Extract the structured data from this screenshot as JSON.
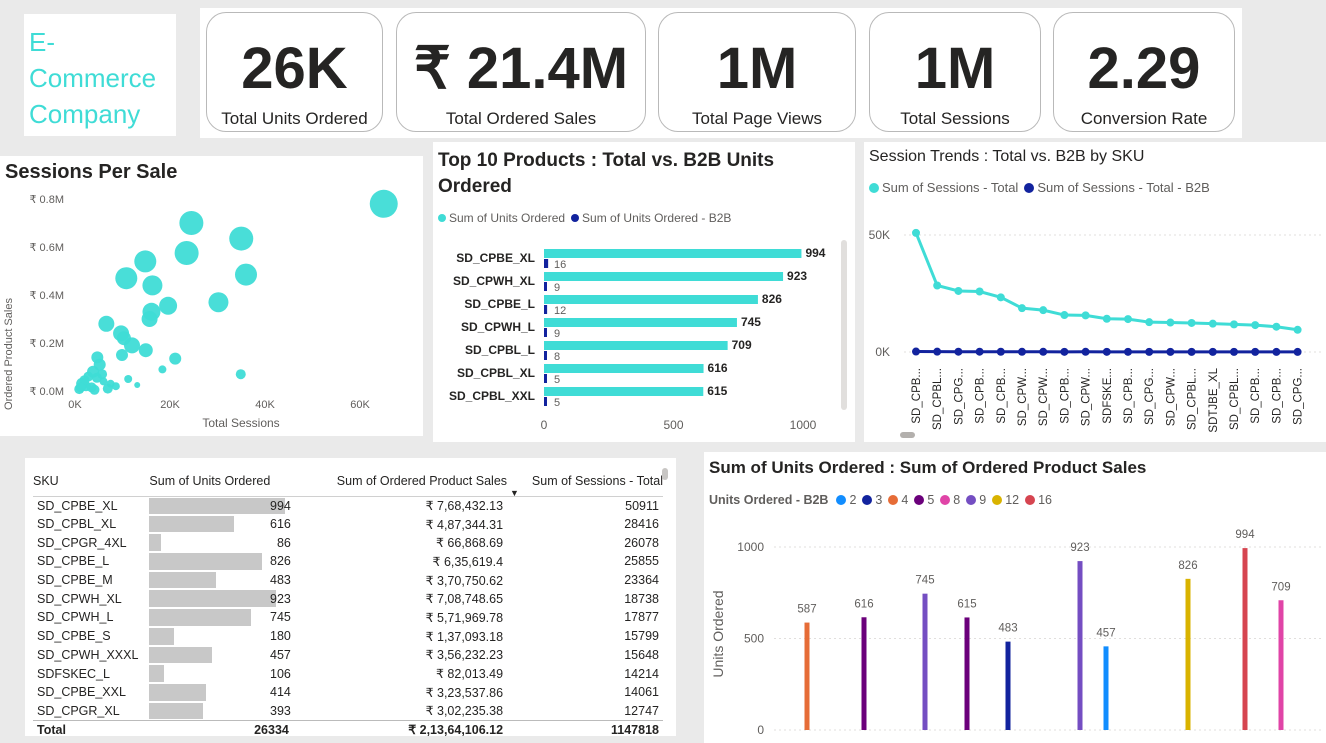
{
  "company": {
    "title": "E-Commerce Company"
  },
  "kpis": [
    {
      "value": "26K",
      "label": "Total Units Ordered"
    },
    {
      "value": "₹ 21.4M",
      "label": "Total Ordered Sales"
    },
    {
      "value": "1M",
      "label": "Total Page Views"
    },
    {
      "value": "1M",
      "label": "Total Sessions"
    },
    {
      "value": "2.29",
      "label": "Conversion Rate"
    }
  ],
  "scatter": {
    "title": "Sessions Per Sale",
    "xlabel": "Total Sessions",
    "ylabel": "Ordered Product Sales",
    "color": "#3fdcd6",
    "xticks": [
      "0K",
      "20K",
      "40K",
      "60K"
    ],
    "yticks": [
      "₹ 0.0M",
      "₹ 0.2M",
      "₹ 0.4M",
      "₹ 0.6M",
      "₹ 0.8M"
    ]
  },
  "top10": {
    "title": "Top 10 Products : Total vs. B2B Units Ordered",
    "legend": [
      "Sum of Units Ordered",
      "Sum of Units Ordered - B2B"
    ],
    "colors": [
      "#3fdcd6",
      "#12239e"
    ],
    "xticks": [
      "0",
      "500",
      "1000"
    ]
  },
  "trend": {
    "title": "Session Trends : Total vs. B2B by SKU",
    "legend": [
      "Sum of Sessions - Total",
      "Sum of Sessions - Total - B2B"
    ],
    "colors": [
      "#3fdcd6",
      "#12239e"
    ],
    "yticks": [
      "50K",
      "0K"
    ]
  },
  "table": {
    "headers": [
      "SKU",
      "Sum of Units Ordered",
      "Sum of Ordered Product Sales",
      "Sum of Sessions - Total"
    ],
    "rows": [
      [
        "SD_CPBE_XL",
        "994",
        "₹ 7,68,432.13",
        "50911"
      ],
      [
        "SD_CPBL_XL",
        "616",
        "₹ 4,87,344.31",
        "28416"
      ],
      [
        "SD_CPGR_4XL",
        "86",
        "₹ 66,868.69",
        "26078"
      ],
      [
        "SD_CPBE_L",
        "826",
        "₹ 6,35,619.4",
        "25855"
      ],
      [
        "SD_CPBE_M",
        "483",
        "₹ 3,70,750.62",
        "23364"
      ],
      [
        "SD_CPWH_XL",
        "923",
        "₹ 7,08,748.65",
        "18738"
      ],
      [
        "SD_CPWH_L",
        "745",
        "₹ 5,71,969.78",
        "17877"
      ],
      [
        "SD_CPBE_S",
        "180",
        "₹ 1,37,093.18",
        "15799"
      ],
      [
        "SD_CPWH_XXXL",
        "457",
        "₹ 3,56,232.23",
        "15648"
      ],
      [
        "SDFSKEC_L",
        "106",
        "₹ 82,013.49",
        "14214"
      ],
      [
        "SD_CPBE_XXL",
        "414",
        "₹ 3,23,537.86",
        "14061"
      ],
      [
        "SD_CPGR_XL",
        "393",
        "₹ 3,02,235.38",
        "12747"
      ]
    ],
    "total": [
      "Total",
      "26334",
      "₹ 2,13,64,106.12",
      "1147818"
    ],
    "bar_max": 994
  },
  "units_chart": {
    "title": "Sum of Units Ordered : Sum of Ordered Product Sales",
    "legend_title": "Units Ordered - B2B",
    "legend": [
      {
        "label": "2",
        "color": "#118dff"
      },
      {
        "label": "3",
        "color": "#12239e"
      },
      {
        "label": "4",
        "color": "#e66c37"
      },
      {
        "label": "5",
        "color": "#6b007b"
      },
      {
        "label": "8",
        "color": "#e044a7"
      },
      {
        "label": "9",
        "color": "#744ec2"
      },
      {
        "label": "12",
        "color": "#d9b300"
      },
      {
        "label": "16",
        "color": "#d64550"
      }
    ],
    "ylabel": "Units Ordered",
    "yticks": [
      "1000",
      "500",
      "0"
    ]
  },
  "chart_data": [
    {
      "type": "scatter",
      "title": "Sessions Per Sale",
      "xlabel": "Total Sessions",
      "ylabel": "Ordered Product Sales",
      "xlim": [
        0,
        70000
      ],
      "ylim": [
        0,
        800000
      ],
      "points": [
        [
          65000,
          780000,
          14
        ],
        [
          24500,
          700000,
          12
        ],
        [
          35000,
          635000,
          12
        ],
        [
          23500,
          575000,
          12
        ],
        [
          36000,
          485000,
          11
        ],
        [
          14800,
          540000,
          11
        ],
        [
          10800,
          470000,
          11
        ],
        [
          16300,
          440000,
          10
        ],
        [
          30200,
          370000,
          10
        ],
        [
          19600,
          355000,
          9
        ],
        [
          16100,
          330000,
          9
        ],
        [
          15700,
          300000,
          8
        ],
        [
          6600,
          280000,
          8
        ],
        [
          9700,
          240000,
          8
        ],
        [
          10300,
          220000,
          7
        ],
        [
          12000,
          190000,
          8
        ],
        [
          14900,
          170000,
          7
        ],
        [
          21100,
          135000,
          6
        ],
        [
          9900,
          150000,
          6
        ],
        [
          4700,
          140000,
          6
        ],
        [
          5200,
          110000,
          6
        ],
        [
          3800,
          80000,
          6
        ],
        [
          5700,
          70000,
          5
        ],
        [
          2800,
          60000,
          5
        ],
        [
          1500,
          30000,
          6
        ],
        [
          2300,
          20000,
          5
        ],
        [
          3500,
          15000,
          5
        ],
        [
          6000,
          40000,
          4
        ],
        [
          7500,
          30000,
          4
        ],
        [
          8600,
          20000,
          4
        ],
        [
          11200,
          50000,
          4
        ],
        [
          18400,
          90000,
          4
        ],
        [
          34900,
          70000,
          5
        ],
        [
          13100,
          25000,
          3
        ],
        [
          900,
          8000,
          5
        ],
        [
          4100,
          5000,
          5
        ],
        [
          6900,
          10000,
          5
        ],
        [
          2000,
          45000,
          5
        ],
        [
          4600,
          55000,
          5
        ],
        [
          1200,
          15000,
          5
        ]
      ]
    },
    {
      "type": "bar",
      "title": "Top 10 Products : Total vs. B2B Units Ordered",
      "orientation": "horizontal",
      "categories": [
        "SD_CPBE_XL",
        "SD_CPWH_XL",
        "SD_CPBE_L",
        "SD_CPWH_L",
        "SD_CPBL_L",
        "SD_CPBL_XL",
        "SD_CPBL_XXL"
      ],
      "series": [
        {
          "name": "Sum of Units Ordered",
          "values": [
            994,
            923,
            826,
            745,
            709,
            616,
            615
          ]
        },
        {
          "name": "Sum of Units Ordered - B2B",
          "values": [
            16,
            9,
            12,
            9,
            8,
            5,
            5
          ]
        }
      ],
      "xlim": [
        0,
        1050
      ]
    },
    {
      "type": "line",
      "title": "Session Trends : Total vs. B2B by SKU",
      "categories": [
        "SD_CPB...",
        "SD_CPBL...",
        "SD_CPG...",
        "SD_CPB...",
        "SD_CPB...",
        "SD_CPW...",
        "SD_CPW...",
        "SD_CPB...",
        "SD_CPW...",
        "SDFSKE...",
        "SD_CPB...",
        "SD_CPG...",
        "SD_CPW...",
        "SD_CPBL...",
        "SDTJBE_XL",
        "SD_CPBL...",
        "SD_CPB...",
        "SD_CPB...",
        "SD_CPG..."
      ],
      "series": [
        {
          "name": "Sum of Sessions - Total",
          "values": [
            50911,
            28416,
            26078,
            25855,
            23364,
            18738,
            17877,
            15799,
            15648,
            14214,
            14061,
            12747,
            12600,
            12400,
            12100,
            11800,
            11500,
            10800,
            9500
          ]
        },
        {
          "name": "Sum of Sessions - Total - B2B",
          "values": [
            200,
            150,
            120,
            130,
            110,
            100,
            90,
            80,
            85,
            70,
            75,
            60,
            60,
            55,
            50,
            52,
            48,
            45,
            40
          ]
        }
      ],
      "ylim": [
        0,
        60000
      ]
    },
    {
      "type": "bar",
      "title": "Sum of Units Ordered : Sum of Ordered Product Sales",
      "ylabel": "Units Ordered",
      "ylim": [
        0,
        1000
      ],
      "bars": [
        {
          "value": 587,
          "b2b": "4"
        },
        {
          "value": 616,
          "b2b": "5"
        },
        {
          "value": 745,
          "b2b": "9"
        },
        {
          "value": 615,
          "b2b": "5"
        },
        {
          "value": 483,
          "b2b": "3"
        },
        {
          "value": 923,
          "b2b": "9"
        },
        {
          "value": 457,
          "b2b": "2"
        },
        {
          "value": 826,
          "b2b": "12"
        },
        {
          "value": 994,
          "b2b": "16"
        },
        {
          "value": 709,
          "b2b": "8"
        }
      ]
    }
  ]
}
